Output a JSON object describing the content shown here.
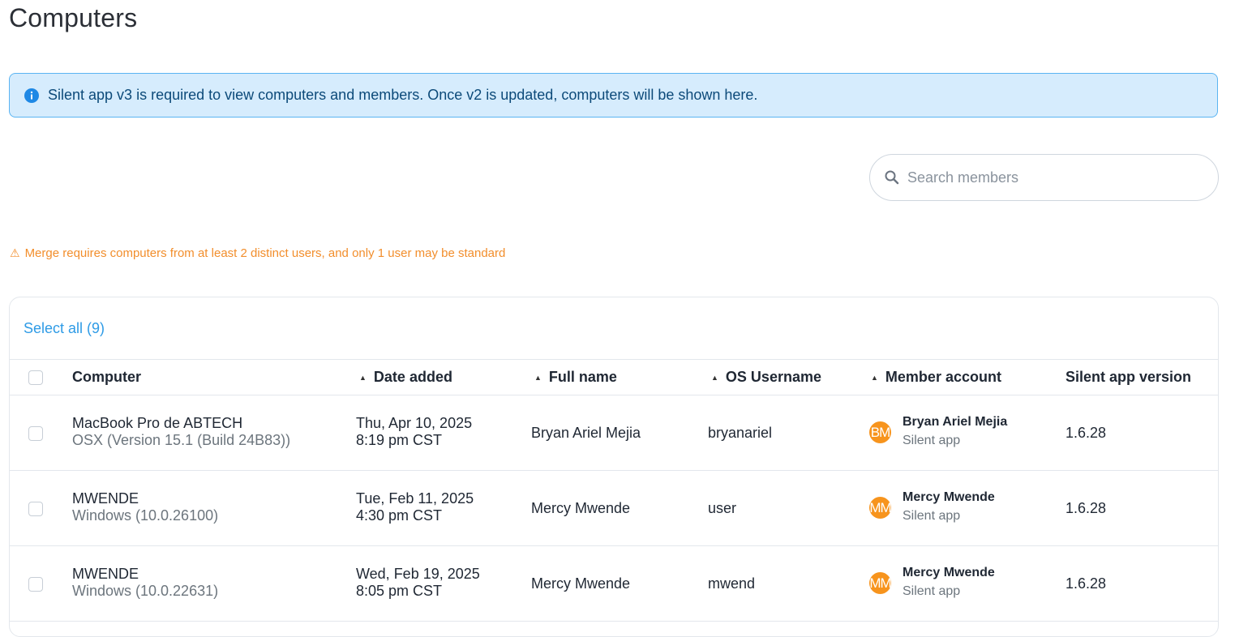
{
  "page": {
    "title": "Computers"
  },
  "banner": {
    "icon": "info-icon",
    "message": "Silent app v3 is required to view computers and members. Once v2 is updated, computers will be shown here."
  },
  "search": {
    "icon": "search-icon",
    "placeholder": "Search members"
  },
  "warning": {
    "icon": "warning-icon",
    "glyph": "⚠",
    "message": "Merge requires computers from at least 2 distinct users, and only 1 user may be standard"
  },
  "table": {
    "select_all_label": "Select all (9)",
    "columns": {
      "computer": "Computer",
      "date_added": "Date added",
      "full_name": "Full name",
      "os_username": "OS Username",
      "member_account": "Member account",
      "app_version": "Silent app version"
    },
    "sort_glyph": "▲",
    "rows": [
      {
        "computer_name": "MacBook Pro de ABTECH",
        "computer_os": "OSX (Version 15.1 (Build 24B83))",
        "date": "Thu, Apr 10, 2025",
        "time": "8:19 pm CST",
        "full_name": "Bryan Ariel Mejia",
        "os_username": "bryanariel",
        "avatar_initials": "BM",
        "member_name": "Bryan Ariel Mejia",
        "member_type": "Silent app",
        "version": "1.6.28"
      },
      {
        "computer_name": "MWENDE",
        "computer_os": "Windows (10.0.26100)",
        "date": "Tue, Feb 11, 2025",
        "time": "4:30 pm CST",
        "full_name": "Mercy Mwende",
        "os_username": "user",
        "avatar_initials": "MM",
        "member_name": "Mercy Mwende",
        "member_type": "Silent app",
        "version": "1.6.28"
      },
      {
        "computer_name": "MWENDE",
        "computer_os": "Windows (10.0.22631)",
        "date": "Wed, Feb 19, 2025",
        "time": "8:05 pm CST",
        "full_name": "Mercy Mwende",
        "os_username": "mwend",
        "avatar_initials": "MM",
        "member_name": "Mercy Mwende",
        "member_type": "Silent app",
        "version": "1.6.28"
      }
    ]
  },
  "colors": {
    "accent": "#2e9be6",
    "warning": "#f28e2c",
    "banner_bg": "#d6ecfd",
    "avatar": "#f7941d"
  }
}
